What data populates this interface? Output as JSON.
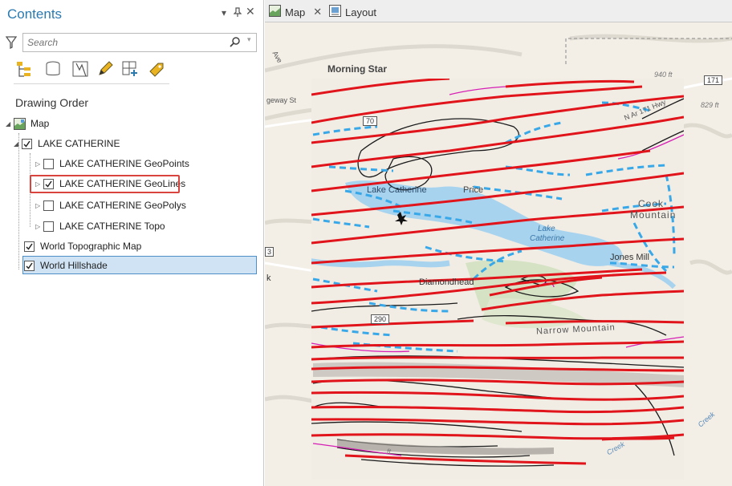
{
  "contents": {
    "title": "Contents",
    "search": {
      "placeholder": "Search"
    },
    "heading": "Drawing Order",
    "tools": [
      "list-by-drawing-order-icon",
      "list-by-source-icon",
      "list-by-selection-icon",
      "list-by-editing-icon",
      "list-by-snapping-icon",
      "list-by-labeling-icon"
    ],
    "tree": {
      "map": "Map",
      "group": "LAKE CATHERINE",
      "layers": [
        {
          "label": "LAKE CATHERINE GeoPoints",
          "checked": false
        },
        {
          "label": "LAKE CATHERINE GeoLines",
          "checked": true
        },
        {
          "label": "LAKE CATHERINE GeoPolys",
          "checked": false
        },
        {
          "label": "LAKE CATHERINE Topo",
          "checked": false
        }
      ],
      "basemaps": [
        {
          "label": "World Topographic Map",
          "checked": true
        },
        {
          "label": "World Hillshade",
          "checked": true
        }
      ]
    }
  },
  "tabs": [
    {
      "label": "Map",
      "closable": true
    },
    {
      "label": "Layout",
      "closable": false
    }
  ],
  "map": {
    "labels": {
      "morning_star": "Morning Star",
      "lake_catherine": "Lake Catherine",
      "price": "Price",
      "cook": "Cook",
      "mountain": "Mountain",
      "lake": "Lake",
      "catherine": "Catherine",
      "jones_mill": "Jones Mill",
      "diamondhead": "Diamondhead",
      "narrow_mountain": "Narrow Mountain",
      "hwy": "N Ar 171 Hwy",
      "ave": "Ave",
      "geway": "geway St",
      "ft940": "940 ft",
      "ft829": "829 ft",
      "creek1": "Creek",
      "creek2": "Creek",
      "k": "k",
      "ft": "ft"
    },
    "shields": {
      "r171": "171",
      "r290": "290",
      "r70": "70",
      "r3": "3"
    },
    "colors": {
      "faults": "#e0141a",
      "contacts": "#1a1a1a",
      "dikes": "#38a8e8",
      "magenta": "#d61fb4",
      "water": "#a8d3ee",
      "land": "#f4f0e8",
      "forest": "#d8e5c8"
    }
  }
}
